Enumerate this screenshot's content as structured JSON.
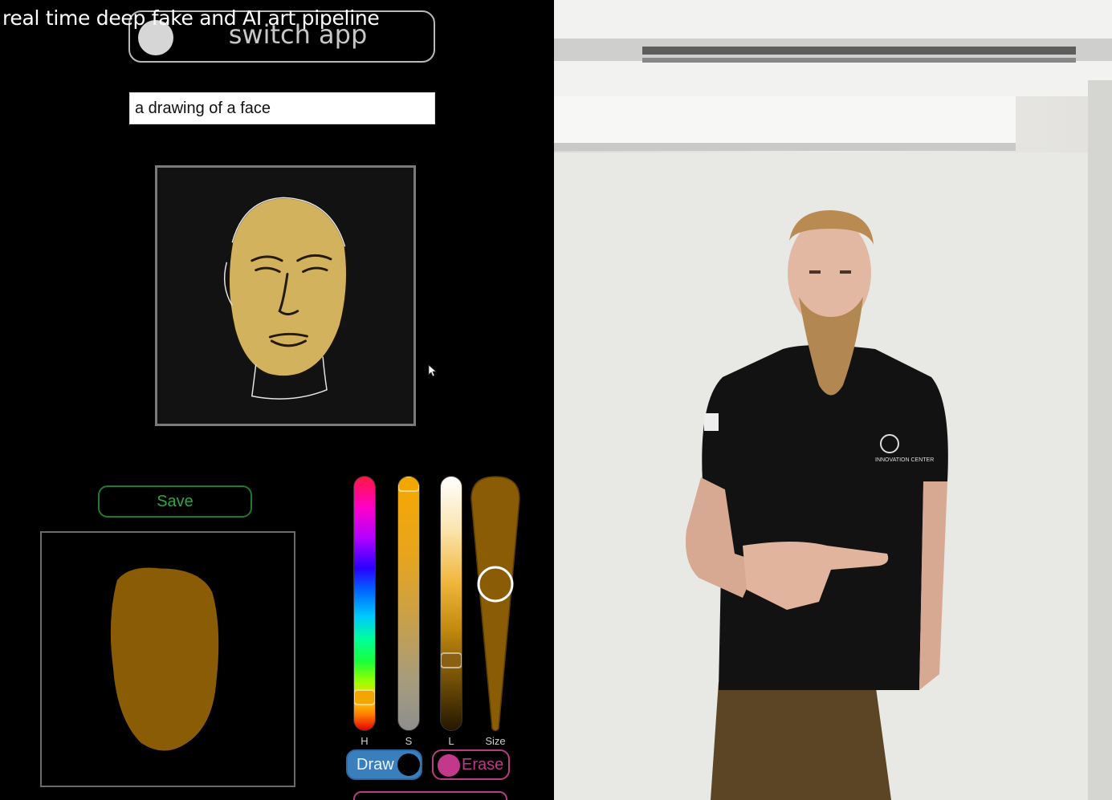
{
  "video": {
    "title": "real time deep fake and AI art pipeline"
  },
  "app": {
    "switch_label": "switch app",
    "prompt_value": "a drawing of a face",
    "save_label": "Save",
    "sliders": {
      "h_label": "H",
      "s_label": "S",
      "l_label": "L",
      "size_label": "Size"
    },
    "draw_label": "Draw",
    "erase_label": "Erase",
    "brush_color": "#8a5c05"
  },
  "camera": {
    "shirt_logo_text": "INNOVATION CENTER"
  }
}
